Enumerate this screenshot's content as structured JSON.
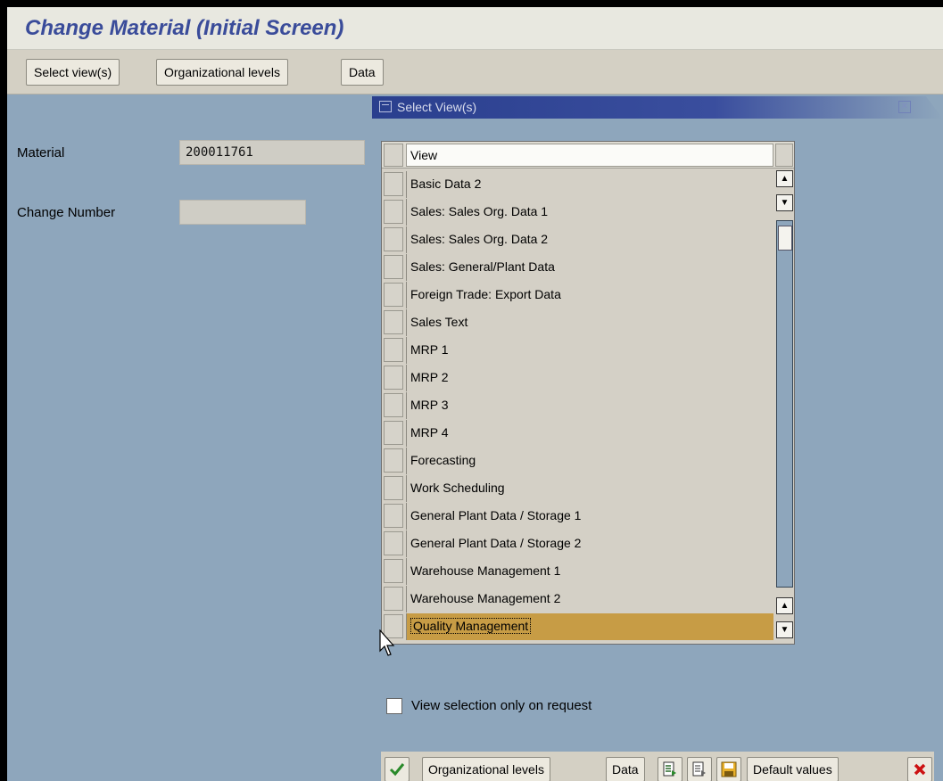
{
  "window": {
    "title": "Change Material (Initial Screen)"
  },
  "toolbar": {
    "select_views": "Select view(s)",
    "org_levels": "Organizational levels",
    "data": "Data"
  },
  "form": {
    "material_label": "Material",
    "material_value": "200011761",
    "change_number_label": "Change Number",
    "change_number_value": ""
  },
  "dialog": {
    "title": "Select View(s)",
    "column_header": "View",
    "rows": [
      "Basic Data 2",
      "Sales: Sales Org. Data 1",
      "Sales: Sales Org. Data 2",
      "Sales: General/Plant Data",
      "Foreign Trade: Export Data",
      "Sales Text",
      "MRP 1",
      "MRP 2",
      "MRP 3",
      "MRP 4",
      "Forecasting",
      "Work Scheduling",
      "General Plant Data / Storage 1",
      "General Plant Data / Storage 2",
      "Warehouse Management 1",
      "Warehouse Management 2",
      "Quality Management"
    ],
    "selected_row": "Quality Management",
    "checkbox_label": "View selection only on request",
    "checkbox_checked": false,
    "footer": {
      "org_levels": "Organizational levels",
      "data": "Data",
      "default_values": "Default values"
    },
    "icons": {
      "confirm": "checkmark-icon",
      "select_all": "select-all-icon",
      "deselect_all": "deselect-all-icon",
      "save": "save-icon",
      "cancel": "cancel-icon"
    }
  },
  "colors": {
    "background": "#8ea6bc",
    "title": "#3a4c9a",
    "selected_row": "#c79c45",
    "dialog_titlebar": "#2a3f8e",
    "confirm": "#2a8a2a",
    "cancel": "#cc1111"
  }
}
